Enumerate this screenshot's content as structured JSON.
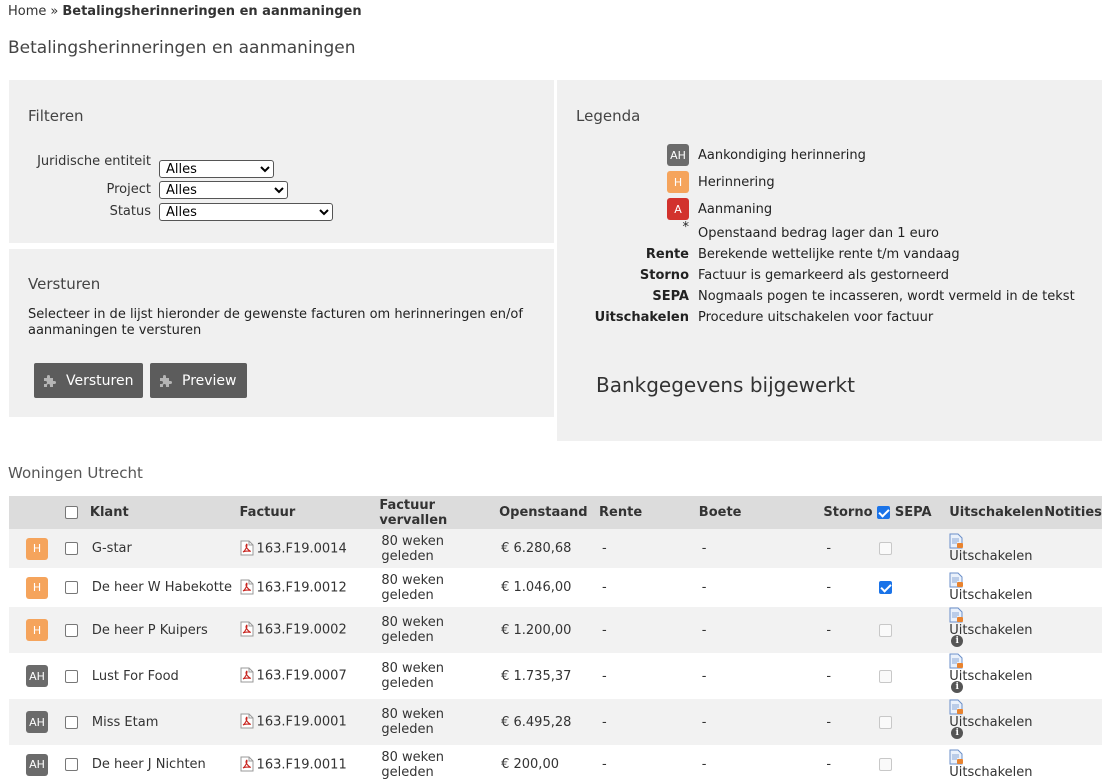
{
  "breadcrumb": {
    "home": "Home",
    "separator": "»",
    "current": "Betalingsherinneringen en aanmaningen"
  },
  "page_title": "Betalingsherinneringen en aanmaningen",
  "filter": {
    "title": "Filteren",
    "entity_label": "Juridische entiteit",
    "entity_value": "Alles",
    "project_label": "Project",
    "project_value": "Alles",
    "status_label": "Status",
    "status_value": "Alles"
  },
  "send": {
    "title": "Versturen",
    "description": "Selecteer in de lijst hieronder de gewenste facturen om herinneringen en/of aanmaningen te versturen",
    "send_button": "Versturen",
    "preview_button": "Preview"
  },
  "legend": {
    "title": "Legenda",
    "items": [
      {
        "key": "AH",
        "text": "Aankondiging herinnering",
        "badge_color": "#6b6b6b"
      },
      {
        "key": "H",
        "text": "Herinnering",
        "badge_color": "#f5a45c"
      },
      {
        "key": "A",
        "text": "Aanmaning",
        "badge_color": "#d2322d"
      },
      {
        "key": "*",
        "text": "Openstaand bedrag lager dan 1 euro"
      },
      {
        "key": "Rente",
        "text": "Berekende wettelijke rente t/m vandaag"
      },
      {
        "key": "Storno",
        "text": "Factuur is gemarkeerd als gestorneerd"
      },
      {
        "key": "SEPA",
        "text": "Nogmaals pogen te incasseren, wordt vermeld in de tekst"
      },
      {
        "key": "Uitschakelen",
        "text": "Procedure uitschakelen voor factuur"
      }
    ],
    "bank_status": "Bankgegevens bijgewerkt"
  },
  "section_title": "Woningen Utrecht",
  "table": {
    "headers": {
      "klant": "Klant",
      "factuur": "Factuur",
      "vervallen": "Factuur vervallen",
      "openstaand": "Openstaand",
      "rente": "Rente",
      "boete": "Boete",
      "storno": "Storno",
      "sepa": "SEPA",
      "uitschakelen": "Uitschakelen",
      "notities": "Notities"
    },
    "rows": [
      {
        "badge": "H",
        "klant": "G-star",
        "factuur": "163.F19.0014",
        "vervallen": "80 weken geleden",
        "openstaand": "€ 6.280,68",
        "rente": "-",
        "boete": "-",
        "storno": "-",
        "sepa_checked": false,
        "uitschakelen": "Uitschakelen",
        "has_note": false
      },
      {
        "badge": "H",
        "klant": "De heer W Habekotte",
        "factuur": "163.F19.0012",
        "vervallen": "80 weken geleden",
        "openstaand": "€ 1.046,00",
        "rente": "-",
        "boete": "-",
        "storno": "-",
        "sepa_checked": true,
        "uitschakelen": "Uitschakelen",
        "has_note": false
      },
      {
        "badge": "H",
        "klant": "De heer P Kuipers",
        "factuur": "163.F19.0002",
        "vervallen": "80 weken geleden",
        "openstaand": "€ 1.200,00",
        "rente": "-",
        "boete": "-",
        "storno": "-",
        "sepa_checked": false,
        "uitschakelen": "Uitschakelen",
        "has_note": true
      },
      {
        "badge": "AH",
        "klant": "Lust For Food",
        "factuur": "163.F19.0007",
        "vervallen": "80 weken geleden",
        "openstaand": "€ 1.735,37",
        "rente": "-",
        "boete": "-",
        "storno": "-",
        "sepa_checked": false,
        "uitschakelen": "Uitschakelen",
        "has_note": true
      },
      {
        "badge": "AH",
        "klant": "Miss Etam",
        "factuur": "163.F19.0001",
        "vervallen": "80 weken geleden",
        "openstaand": "€ 6.495,28",
        "rente": "-",
        "boete": "-",
        "storno": "-",
        "sepa_checked": false,
        "uitschakelen": "Uitschakelen",
        "has_note": true
      },
      {
        "badge": "AH",
        "klant": "De heer J Nichten",
        "factuur": "163.F19.0011",
        "vervallen": "80 weken geleden",
        "openstaand": "€ 200,00",
        "rente": "-",
        "boete": "-",
        "storno": "-",
        "sepa_checked": false,
        "uitschakelen": "Uitschakelen",
        "has_note": false
      }
    ]
  },
  "icons": {
    "pdf": "pdf-file-icon",
    "disable": "document-disable-icon",
    "note": "info-icon",
    "button": "puzzle-icon"
  }
}
